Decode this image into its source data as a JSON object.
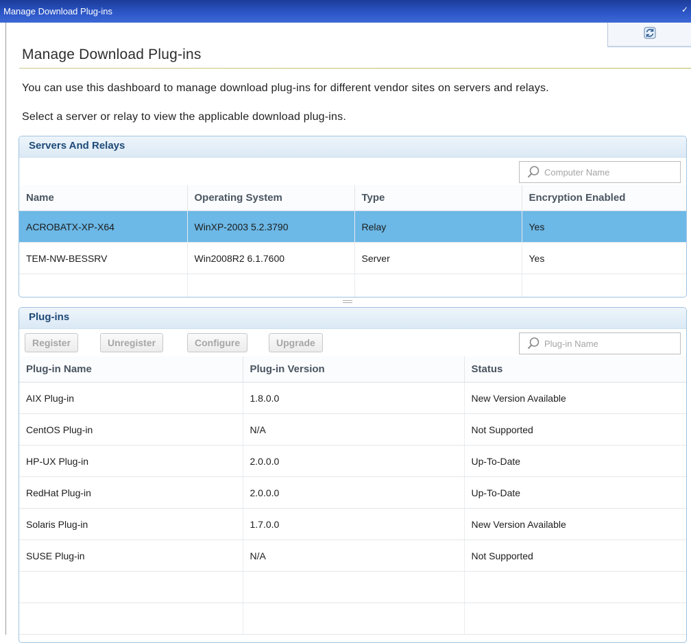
{
  "window": {
    "title": "Manage Download Plug-ins"
  },
  "page": {
    "heading": "Manage Download Plug-ins",
    "description": "You can use this dashboard to manage download plug-ins for different vendor sites on servers and relays.",
    "instruction": "Select a server or relay to view the applicable download plug-ins."
  },
  "icons": {
    "refresh": "refresh-icon",
    "search": "search-icon",
    "titlebar": "window-control-icon"
  },
  "colors": {
    "titlebar": "#2b55c6",
    "selection": "#6cb8e6",
    "panel_title": "#1f4a77"
  },
  "servers": {
    "title": "Servers And Relays",
    "search_placeholder": "Computer Name",
    "columns": [
      "Name",
      "Operating System",
      "Type",
      "Encryption Enabled"
    ],
    "rows": [
      {
        "name": "ACROBATX-XP-X64",
        "os": "WinXP-2003 5.2.3790",
        "type": "Relay",
        "encryption": "Yes",
        "selected": true
      },
      {
        "name": "TEM-NW-BESSRV",
        "os": "Win2008R2 6.1.7600",
        "type": "Server",
        "encryption": "Yes",
        "selected": false
      }
    ]
  },
  "plugins": {
    "title": "Plug-ins",
    "buttons": {
      "register": "Register",
      "unregister": "Unregister",
      "configure": "Configure",
      "upgrade": "Upgrade"
    },
    "search_placeholder": "Plug-in Name",
    "columns": [
      "Plug-in Name",
      "Plug-in Version",
      "Status"
    ],
    "rows": [
      {
        "name": "AIX Plug-in",
        "version": "1.8.0.0",
        "status": "New Version Available"
      },
      {
        "name": "CentOS Plug-in",
        "version": "N/A",
        "status": "Not Supported"
      },
      {
        "name": "HP-UX Plug-in",
        "version": "2.0.0.0",
        "status": "Up-To-Date"
      },
      {
        "name": "RedHat Plug-in",
        "version": "2.0.0.0",
        "status": "Up-To-Date"
      },
      {
        "name": "Solaris Plug-in",
        "version": "1.7.0.0",
        "status": "New Version Available"
      },
      {
        "name": "SUSE Plug-in",
        "version": "N/A",
        "status": "Not Supported"
      }
    ]
  }
}
